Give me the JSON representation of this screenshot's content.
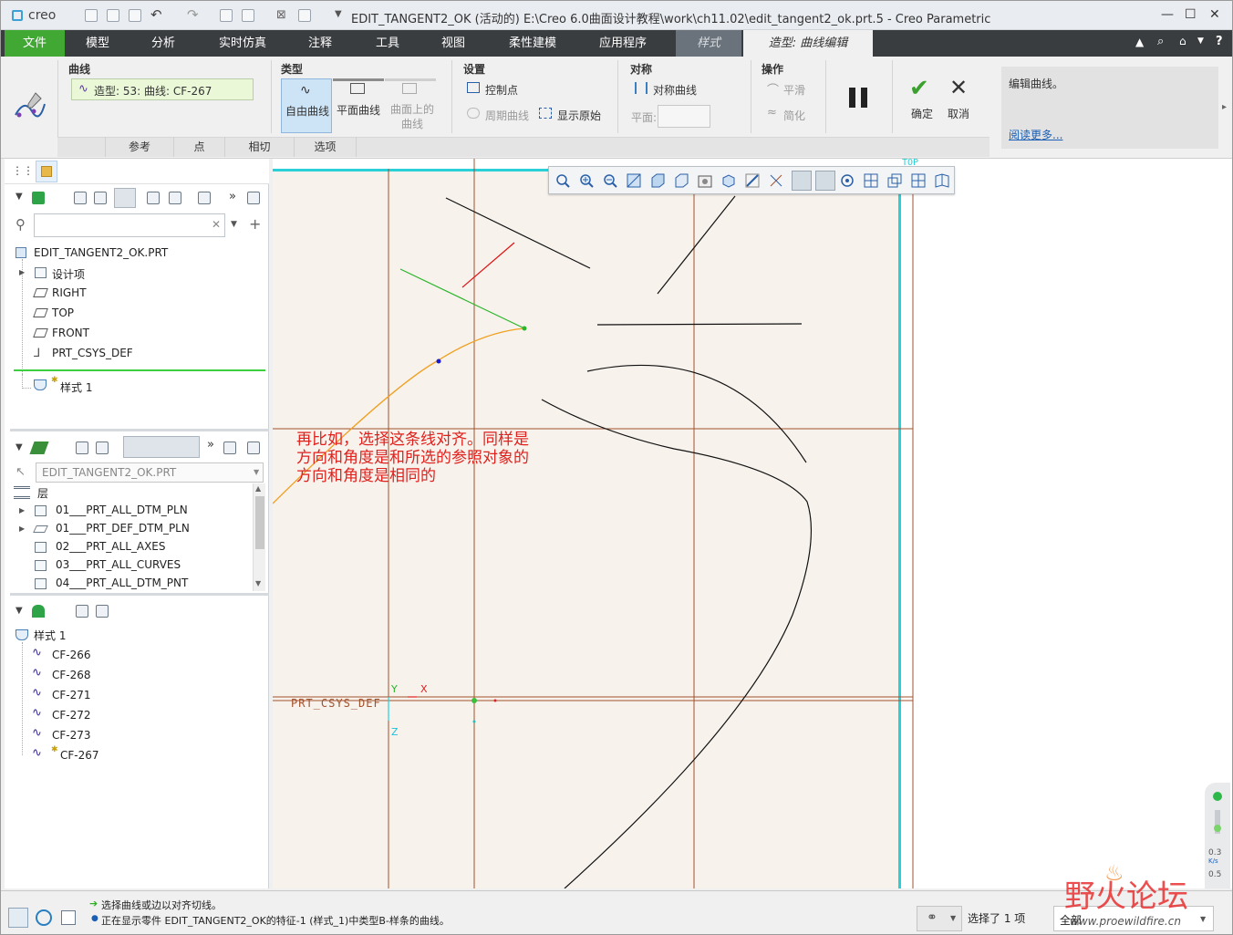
{
  "titlebar": {
    "logo": "creo",
    "title": "EDIT_TANGENT2_OK (活动的) E:\\Creo 6.0曲面设计教程\\work\\ch11.02\\edit_tangent2_ok.prt.5 - Creo Parametric",
    "minimize": "—",
    "maximize": "☐",
    "close": "✕"
  },
  "menubar": {
    "items": [
      "文件",
      "模型",
      "分析",
      "实时仿真",
      "注释",
      "工具",
      "视图",
      "柔性建模",
      "应用程序",
      "样式",
      "造型: 曲线编辑"
    ]
  },
  "ribbon": {
    "curve_group_title": "曲线",
    "curve_field_value": "造型: 53: 曲线: CF-267",
    "type_group_title": "类型",
    "type_free": "自由曲线",
    "type_planar": "平面曲线",
    "type_on_surface": "曲面上的曲线",
    "settings_group_title": "设置",
    "control_points": "控制点",
    "periodic_curve": "周期曲线",
    "show_original": "显示原始",
    "symmetry_group_title": "对称",
    "symmetric_curve": "对称曲线",
    "plane_label": "平面:",
    "operations_group_title": "操作",
    "smooth": "平滑",
    "simplify": "简化",
    "confirm": "确定",
    "cancel": "取消",
    "help_text": "编辑曲线。",
    "read_more": "阅读更多...",
    "subtabs": [
      "参考",
      "点",
      "相切",
      "选项"
    ]
  },
  "model_tree": {
    "root": "EDIT_TANGENT2_OK.PRT",
    "items": [
      "设计项",
      "RIGHT",
      "TOP",
      "FRONT",
      "PRT_CSYS_DEF"
    ],
    "insert_item": "样式 1"
  },
  "layer_tree": {
    "part_select": "EDIT_TANGENT2_OK.PRT",
    "header": "层",
    "items": [
      "01___PRT_ALL_DTM_PLN",
      "01___PRT_DEF_DTM_PLN",
      "02___PRT_ALL_AXES",
      "03___PRT_ALL_CURVES",
      "04___PRT_ALL_DTM_PNT"
    ]
  },
  "style_tree": {
    "root": "样式 1",
    "items": [
      "CF-266",
      "CF-268",
      "CF-271",
      "CF-272",
      "CF-273",
      "CF-267"
    ]
  },
  "graphics": {
    "annotation_lines": [
      "再比如，选择这条线对齐。同样是",
      "方向和角度是和所选的参照对象的",
      "方向和角度是相同的"
    ],
    "csys_label": "PRT_CSYS_DEF",
    "axis_x": "X",
    "axis_y": "Y",
    "axis_z": "Z",
    "top_label": "TOP",
    "gauge_top": "0.3",
    "gauge_bottom": "0.5",
    "gauge_unit": "K/s"
  },
  "status": {
    "line1": "选择曲线或边以对齐切线。",
    "line2": "正在显示零件 EDIT_TANGENT2_OK的特征-1 (样式_1)中类型B-样条的曲线。",
    "selected": "选择了 1 项",
    "filter": "全部"
  },
  "watermark": {
    "text_cn": "野火论坛",
    "url": "www.proewildfire.cn"
  },
  "colors": {
    "accent_green": "#41a833",
    "menubar_bg": "#3a3d40",
    "annotation_red": "#e0201c",
    "curve_orange": "#f0a020",
    "datum_brown": "#a0522d",
    "plane_cyan": "#2ad0d8",
    "link_blue": "#1a5fb4"
  }
}
